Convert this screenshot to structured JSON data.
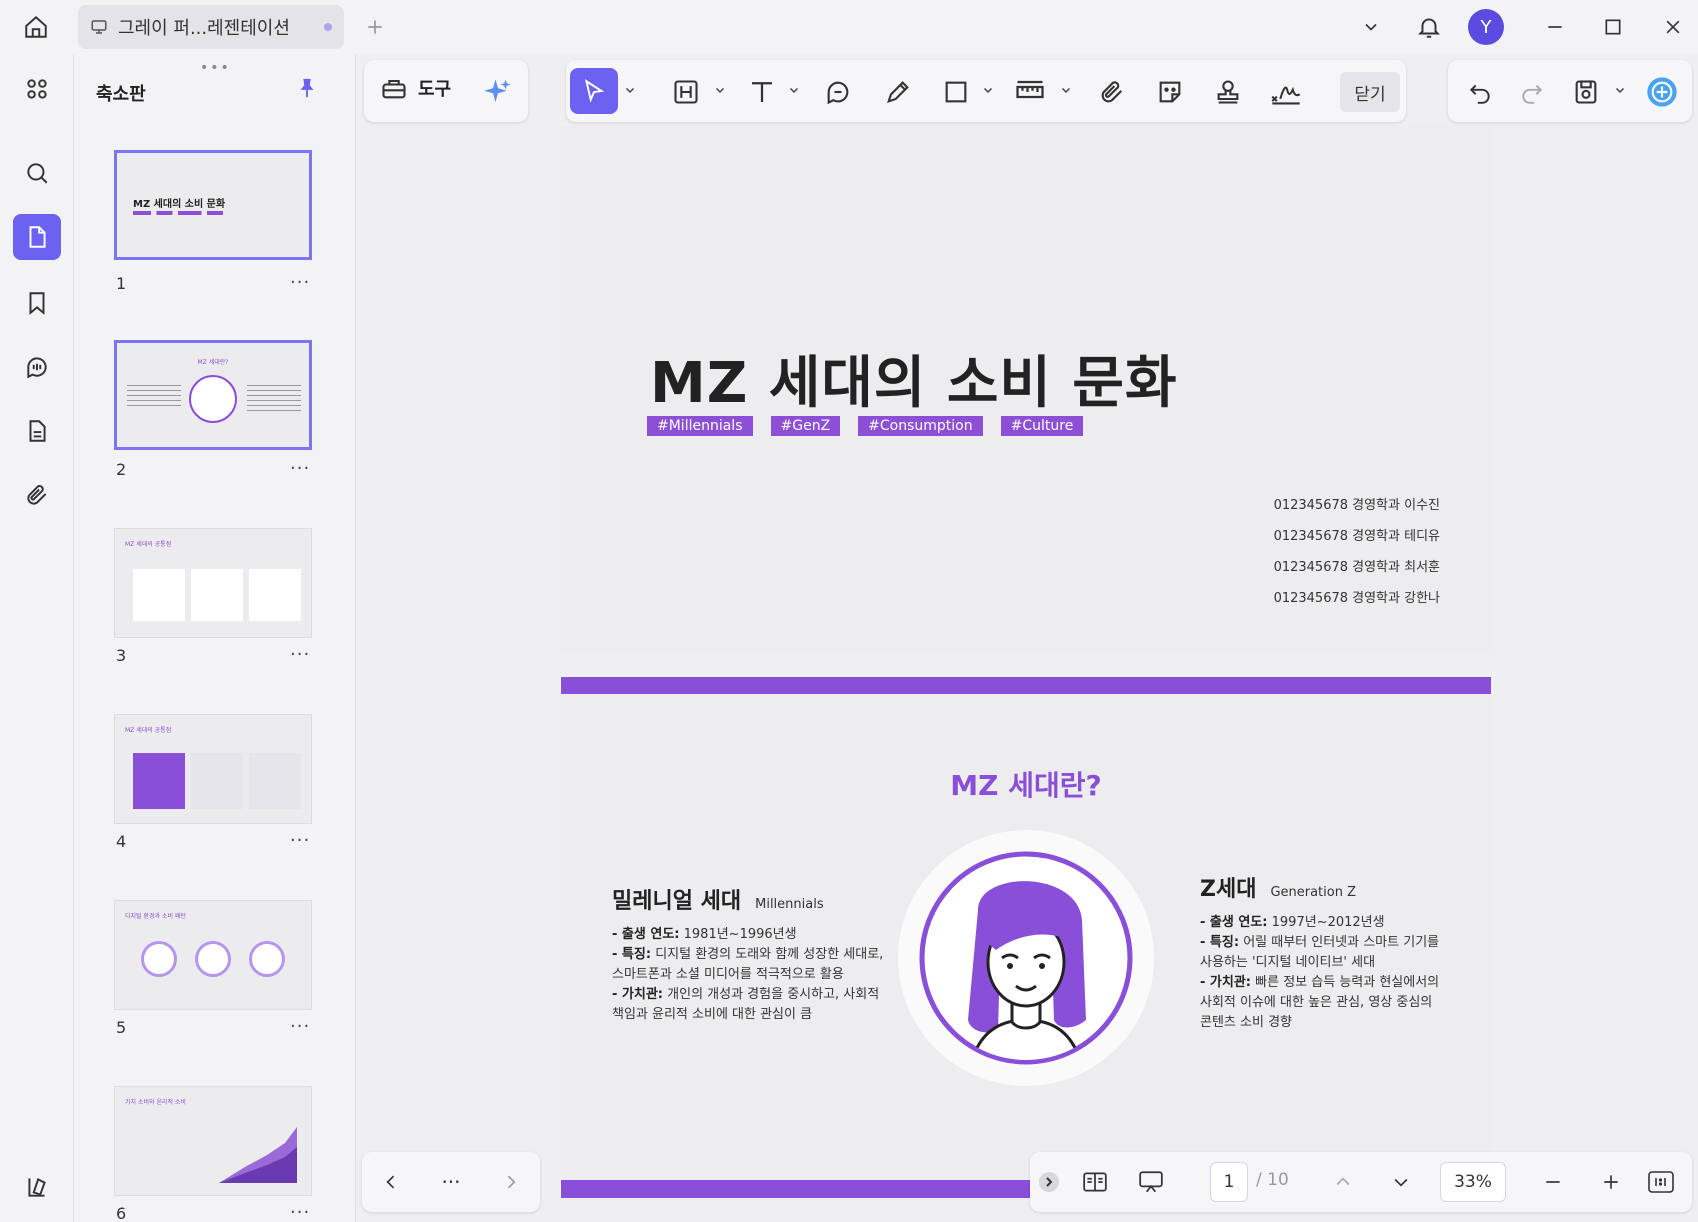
{
  "titlebar": {
    "tab_title": "그레이 퍼...레젠테이션",
    "avatar_initial": "Y"
  },
  "thumbnails": {
    "title": "축소판",
    "pages": [
      {
        "num": "1",
        "label": "MZ 세대의 소비 문화"
      },
      {
        "num": "2",
        "label": "MZ 세대란?"
      },
      {
        "num": "3",
        "label": "MZ 세대의 공통점"
      },
      {
        "num": "4",
        "label": "MZ 세대의 공통점"
      },
      {
        "num": "5",
        "label": "디지털 환경과 소비 패턴"
      },
      {
        "num": "6",
        "label": "가치 소비와 윤리적 소비"
      }
    ],
    "more_label": "···"
  },
  "toolbar": {
    "tools_label": "도구",
    "close_label": "닫기"
  },
  "slide1": {
    "title": "MZ 세대의 소비 문화",
    "tags": [
      "#Millennials",
      "#GenZ",
      "#Consumption",
      "#Culture"
    ],
    "authors": [
      "012345678 경영학과 이수진",
      "012345678 경영학과 테디유",
      "012345678 경영학과 최서훈",
      "012345678 경영학과 강한나"
    ]
  },
  "slide2": {
    "title": "MZ 세대란?",
    "left": {
      "heading": "밀레니얼 세대",
      "sub": "Millennials",
      "birth_label": "- 출생 연도:",
      "birth_value": "1981년~1996년생",
      "feature_label": "- 특징:",
      "feature_value": "디지털 환경의 도래와 함께 성장한 세대로, 스마트폰과 소셜 미디어를 적극적으로 활용",
      "value_label": "- 가치관:",
      "value_value": "개인의 개성과 경험을 중시하고, 사회적 책임과 윤리적 소비에 대한 관심이 큼"
    },
    "right": {
      "heading": "Z세대",
      "sub": "Generation Z",
      "birth_label": "- 출생 연도:",
      "birth_value": "1997년~2012년생",
      "feature_label": "- 특징:",
      "feature_value": "어릴 때부터 인터넷과 스마트 기기를 사용하는 '디지털 네이티브' 세대",
      "value_label": "- 가치관:",
      "value_value": "빠른 정보 습득 능력과 현실에서의 사회적 이슈에 대한 높은 관심, 영상 중심의 콘텐츠 소비 경향"
    }
  },
  "bottom": {
    "more_label": "···",
    "page_current": "1",
    "page_total": "/ 10",
    "zoom": "33%"
  },
  "colors": {
    "accent": "#6b62f2",
    "purple": "#8a4fd8"
  }
}
